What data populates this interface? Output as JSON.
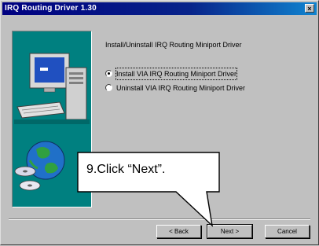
{
  "window": {
    "title": "IRQ Routing Driver 1.30",
    "close_glyph": "×"
  },
  "content": {
    "instruction": "Install/Uninstall IRQ Routing Miniport Driver",
    "options": [
      {
        "label": "Install VIA IRQ Routing Miniport Driver",
        "selected": true
      },
      {
        "label": "Uninstall VIA IRQ Routing Miniport Driver",
        "selected": false
      }
    ]
  },
  "buttons": {
    "back": "< Back",
    "next": "Next >",
    "cancel": "Cancel"
  },
  "callout": {
    "text": "9.Click “Next”."
  },
  "icons": [
    "computer-illustration",
    "globe-icon",
    "close-icon",
    "radio-icon"
  ]
}
